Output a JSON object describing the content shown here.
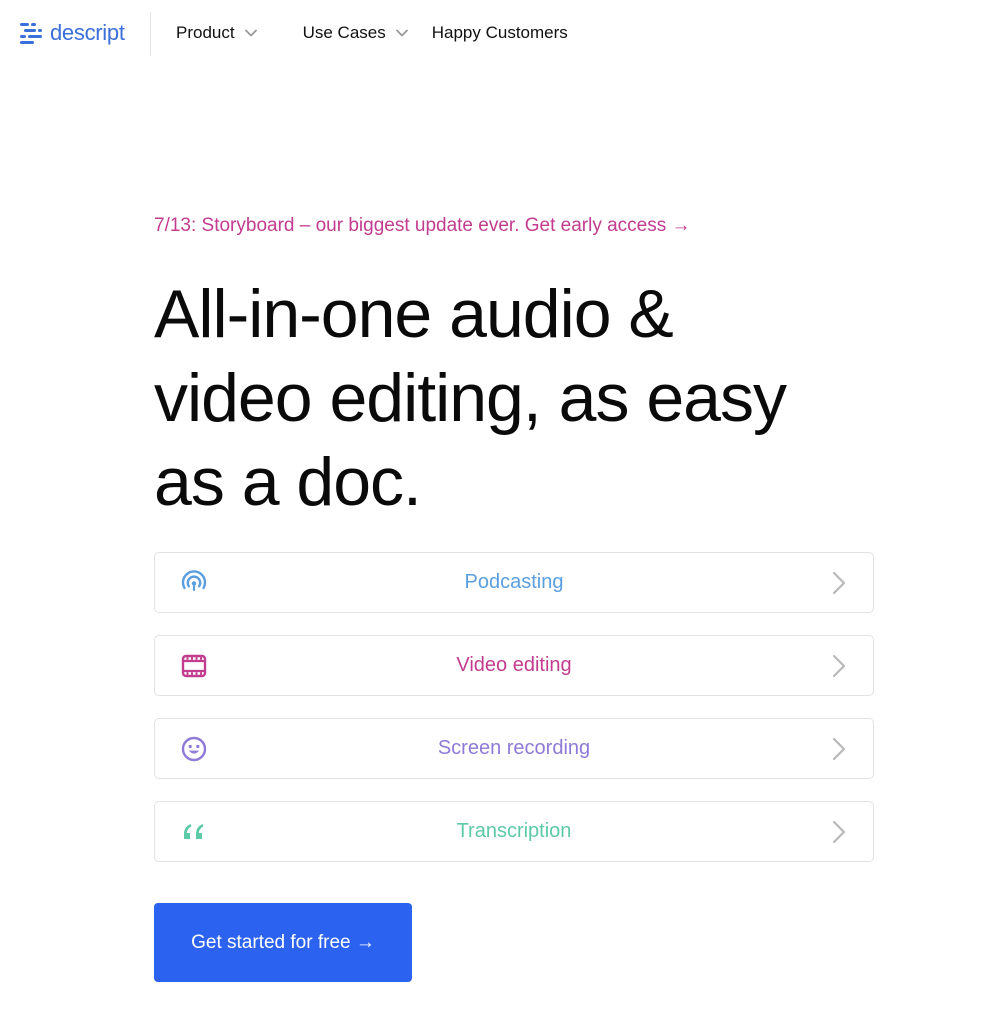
{
  "brand": {
    "name": "descript",
    "color": "#3b6fd9"
  },
  "nav": {
    "items": [
      {
        "label": "Product",
        "has_dropdown": true
      },
      {
        "label": "Use Cases",
        "has_dropdown": true
      },
      {
        "label": "Happy Customers",
        "has_dropdown": false
      }
    ]
  },
  "hero": {
    "announcement": "7/13: Storyboard – our biggest update ever. Get early access →",
    "announcement_color": "#c23c8f",
    "headline_lines": [
      "All-in-one audio &",
      "video editing, as easy",
      "as a doc."
    ]
  },
  "use_cases": [
    {
      "label": "Podcasting",
      "icon": "podcast-icon",
      "color": "#5a9ee0"
    },
    {
      "label": "Video editing",
      "icon": "film-icon",
      "color": "#c23c8f"
    },
    {
      "label": "Screen recording",
      "icon": "smiley-icon",
      "color": "#8f7ad8"
    },
    {
      "label": "Transcription",
      "icon": "quote-icon",
      "color": "#5cc9a7"
    }
  ],
  "cta": {
    "label": "Get started for free →",
    "color": "#2c62f0"
  }
}
